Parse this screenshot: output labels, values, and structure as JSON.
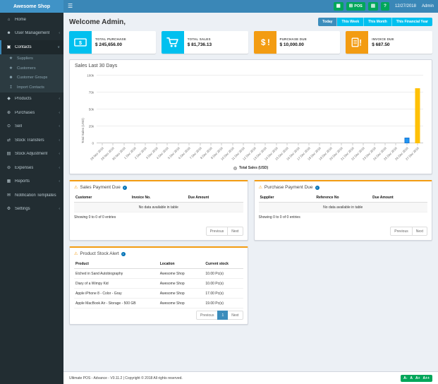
{
  "theme": {
    "header-blue": "#3a87b7",
    "brand-blue": "#4093c7",
    "sidebar-dark": "#222d32",
    "content-bg": "#ecf0f5",
    "green": "#00a65a",
    "cyan": "#00c0ef",
    "orange": "#f39c12",
    "active-blue": "#3c8dbc"
  },
  "icons": {
    "hamburger": "☰",
    "chevron-left": "‹",
    "chevron-down": "∨",
    "home": "⌂",
    "users": "☻",
    "address-book": "▣",
    "star": "★",
    "import": "↥",
    "cubes": "◆",
    "plus-circle": "⊕",
    "dot-circle": "⊙",
    "exchange": "⇄",
    "database": "▤",
    "minus-circle": "⊖",
    "bar-chart": "▦",
    "envelope": "✉",
    "gear": "⚙",
    "calculator": "▦",
    "grid": "⊞",
    "money": "▤",
    "question": "?",
    "warning": "⚠",
    "info": "i"
  },
  "header": {
    "brand": "Awesome Shop",
    "date": "12/27/2018",
    "user": "Admin",
    "buttons": [
      {
        "name": "calculator-button",
        "icon": "calculator"
      },
      {
        "name": "pos-button",
        "icon": "grid",
        "label": "POS"
      },
      {
        "name": "register-button",
        "icon": "money"
      },
      {
        "name": "help-button",
        "icon": "question"
      }
    ]
  },
  "sidebar": {
    "items": [
      {
        "label": "Home",
        "icon": "home"
      },
      {
        "label": "User Management",
        "icon": "users",
        "chevron": "left"
      },
      {
        "label": "Contacts",
        "icon": "address-book",
        "chevron": "down",
        "active": true,
        "children": [
          {
            "label": "Suppliers",
            "icon": "star"
          },
          {
            "label": "Customers",
            "icon": "star"
          },
          {
            "label": "Customer Groups",
            "icon": "users"
          },
          {
            "label": "Import Contacts",
            "icon": "import"
          }
        ]
      },
      {
        "label": "Products",
        "icon": "cubes",
        "chevron": "left"
      },
      {
        "label": "Purchases",
        "icon": "plus-circle",
        "chevron": "left"
      },
      {
        "label": "Sell",
        "icon": "dot-circle",
        "chevron": "left"
      },
      {
        "label": "Stock Transfers",
        "icon": "exchange",
        "chevron": "left"
      },
      {
        "label": "Stock Adjustment",
        "icon": "database",
        "chevron": "left"
      },
      {
        "label": "Expenses",
        "icon": "minus-circle",
        "chevron": "left"
      },
      {
        "label": "Reports",
        "icon": "bar-chart",
        "chevron": "left"
      },
      {
        "label": "Notification Templates",
        "icon": "envelope"
      },
      {
        "label": "Settings",
        "icon": "gear",
        "chevron": "left"
      }
    ]
  },
  "main": {
    "welcome": "Welcome Admin,"
  },
  "filters": {
    "active": "Today",
    "options": [
      "Today",
      "This Week",
      "This Month",
      "This Financial Year"
    ]
  },
  "cards": [
    {
      "label": "TOTAL PURCHASE",
      "value": "$ 245,656.00",
      "color": "#00c0ef",
      "icon": "money-check"
    },
    {
      "label": "TOTAL SALES",
      "value": "$ 81,736.13",
      "color": "#00c0ef",
      "icon": "cart"
    },
    {
      "label": "PURCHASE DUE",
      "value": "$ 10,000.00",
      "color": "#f39c12",
      "icon": "dollar-alert"
    },
    {
      "label": "INVOICE DUE",
      "value": "$ 687.50",
      "color": "#f39c12",
      "icon": "invoice-alert"
    }
  ],
  "chart_data": {
    "type": "bar",
    "title": "Sales Last 30 Days",
    "xlabel": "",
    "ylabel": "Total Sales (USD)",
    "ylim": [
      0,
      100000
    ],
    "yticks": [
      0,
      25000,
      50000,
      75000,
      100000
    ],
    "ytick_labels": [
      "0",
      "25k",
      "50k",
      "75k",
      "100k"
    ],
    "grid": true,
    "legend_position": "bottom",
    "categories": [
      "28 Nov 2018",
      "29 Nov 2018",
      "30 Nov 2018",
      "1 Dec 2018",
      "2 Dec 2018",
      "3 Dec 2018",
      "4 Dec 2018",
      "5 Dec 2018",
      "6 Dec 2018",
      "7 Dec 2018",
      "8 Dec 2018",
      "9 Dec 2018",
      "10 Dec 2018",
      "11 Dec 2018",
      "12 Dec 2018",
      "13 Dec 2018",
      "14 Dec 2018",
      "15 Dec 2018",
      "16 Dec 2018",
      "17 Dec 2018",
      "18 Dec 2018",
      "19 Dec 2018",
      "20 Dec 2018",
      "21 Dec 2018",
      "22 Dec 2018",
      "23 Dec 2018",
      "24 Dec 2018",
      "25 Dec 2018",
      "26 Dec 2018",
      "27 Dec 2018"
    ],
    "series": [
      {
        "name": "Total Sales (USD)",
        "values": [
          0,
          0,
          0,
          0,
          0,
          0,
          0,
          0,
          0,
          0,
          0,
          0,
          0,
          0,
          0,
          0,
          0,
          0,
          0,
          0,
          0,
          0,
          0,
          0,
          0,
          0,
          0,
          0,
          8000,
          81736.13
        ]
      }
    ],
    "default_bar_color": "#2196f3",
    "bar_colors": {
      "28": "#2196f3",
      "29": "#ffc107"
    },
    "bar_borders": {
      "28": "#1976d2"
    }
  },
  "panels": {
    "sales_payment_due": {
      "title": "Sales Payment Due",
      "columns": [
        "Customer",
        "Invoice No.",
        "Due Amount"
      ],
      "empty_text": "No data available in table",
      "showing_text": "Showing 0 to 0 of 0 entries",
      "prev_label": "Previous",
      "next_label": "Next"
    },
    "purchase_payment_due": {
      "title": "Purchase Payment Due",
      "columns": [
        "Supplier",
        "Reference No",
        "Due Amount"
      ],
      "empty_text": "No data available in table",
      "showing_text": "Showing 0 to 0 of 0 entries",
      "prev_label": "Previous",
      "next_label": "Next"
    },
    "product_stock_alert": {
      "title": "Product Stock Alert",
      "columns": [
        "Product",
        "Location",
        "Current stock"
      ],
      "rows": [
        [
          "Etched in Sand Autobiography",
          "Awesome Shop",
          "10.00 Pc(s)"
        ],
        [
          "Diary of a Wimpy Kid",
          "Awesome Shop",
          "10.00 Pc(s)"
        ],
        [
          "Apple iPhone 8 - Color - Gray",
          "Awesome Shop",
          "17.00 Pc(s)"
        ],
        [
          "Apple MacBook Air - Storage - 500 GB",
          "Awesome Shop",
          "19.00 Pc(s)"
        ]
      ],
      "pagination": {
        "prev": "Previous",
        "page": "1",
        "next": "Next"
      }
    }
  },
  "footer": {
    "text": "Ultimate POS - Advance - V0.11.2 | Copyright © 2018 All rights reserved.",
    "font_controls": [
      "A-",
      "A",
      "A+",
      "A++"
    ]
  }
}
